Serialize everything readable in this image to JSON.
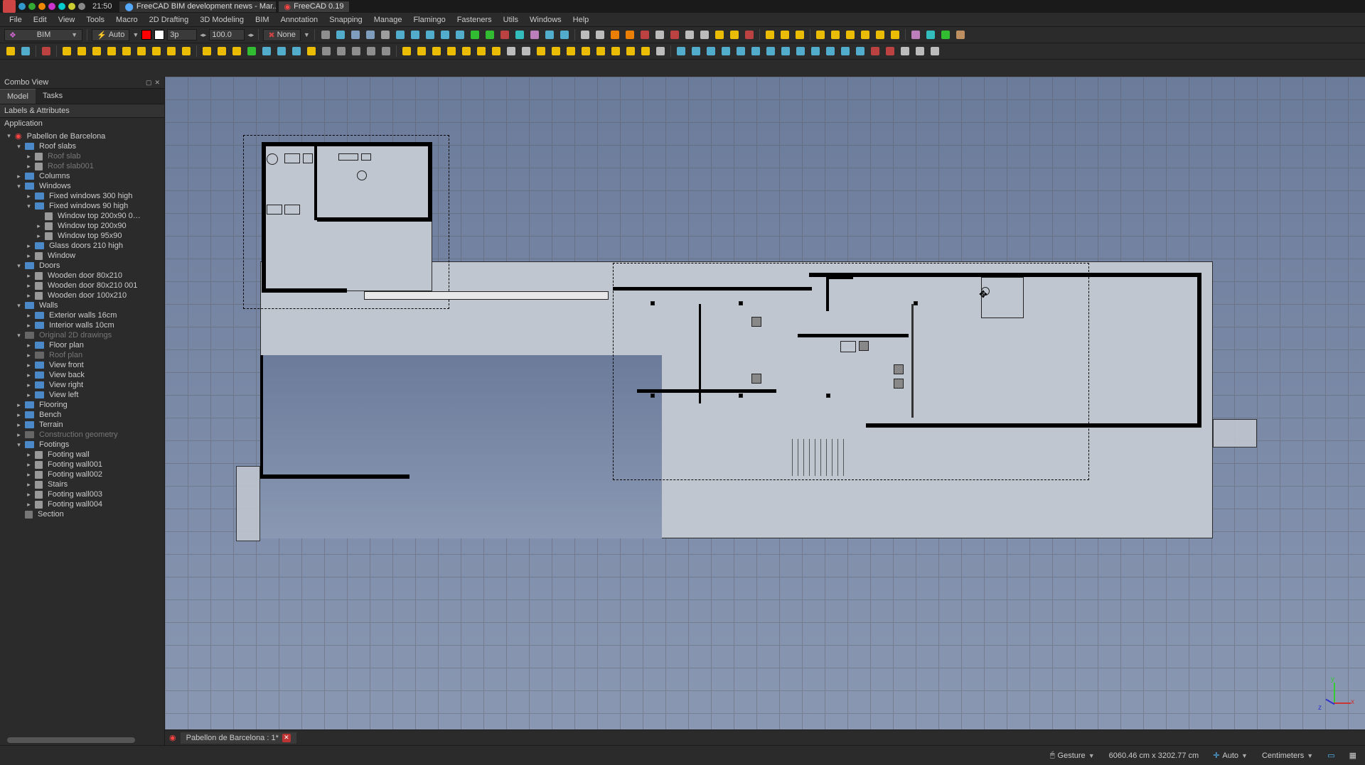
{
  "os": {
    "clock": "21:50",
    "tabs": [
      {
        "title": "FreeCAD BIM development news - Mar...",
        "active": false
      },
      {
        "title": "FreeCAD 0.19",
        "active": true
      }
    ]
  },
  "menubar": [
    "File",
    "Edit",
    "View",
    "Tools",
    "Macro",
    "2D Drafting",
    "3D Modeling",
    "BIM",
    "Annotation",
    "Snapping",
    "Manage",
    "Flamingo",
    "Fasteners",
    "Utils",
    "Windows",
    "Help"
  ],
  "toolbar1": {
    "workbench": "BIM",
    "autoGroup": "Auto",
    "colorPrimary": "#ff0000",
    "colorSecondary": "#ffffff",
    "lineWidth": "3p",
    "scale": "100.0",
    "constructMode": "None"
  },
  "combo": {
    "title": "Combo View",
    "tabs": [
      "Model",
      "Tasks"
    ],
    "activeTab": "Model",
    "sectionLabels": "Labels & Attributes",
    "sectionApp": "Application"
  },
  "tree": [
    {
      "d": 0,
      "t": "doc",
      "open": true,
      "label": "Pabellon de Barcelona"
    },
    {
      "d": 1,
      "t": "folder",
      "open": true,
      "label": "Roof slabs"
    },
    {
      "d": 2,
      "t": "item",
      "open": false,
      "label": "Roof slab",
      "dim": true
    },
    {
      "d": 2,
      "t": "item",
      "open": false,
      "label": "Roof slab001",
      "dim": true
    },
    {
      "d": 1,
      "t": "folder",
      "open": false,
      "label": "Columns"
    },
    {
      "d": 1,
      "t": "folder",
      "open": true,
      "label": "Windows"
    },
    {
      "d": 2,
      "t": "folder",
      "open": false,
      "label": "Fixed windows 300 high"
    },
    {
      "d": 2,
      "t": "folder",
      "open": true,
      "label": "Fixed windows 90 high"
    },
    {
      "d": 3,
      "t": "item",
      "open": false,
      "label": "Window top 200x90 0…",
      "notoggle": true
    },
    {
      "d": 3,
      "t": "item",
      "open": false,
      "label": "Window top 200x90"
    },
    {
      "d": 3,
      "t": "item",
      "open": false,
      "label": "Window top 95x90"
    },
    {
      "d": 2,
      "t": "folder",
      "open": false,
      "label": "Glass doors 210 high"
    },
    {
      "d": 2,
      "t": "item",
      "open": false,
      "label": "Window"
    },
    {
      "d": 1,
      "t": "folder",
      "open": true,
      "label": "Doors"
    },
    {
      "d": 2,
      "t": "item",
      "open": false,
      "label": "Wooden door 80x210"
    },
    {
      "d": 2,
      "t": "item",
      "open": false,
      "label": "Wooden door 80x210 001"
    },
    {
      "d": 2,
      "t": "item",
      "open": false,
      "label": "Wooden door 100x210"
    },
    {
      "d": 1,
      "t": "folder",
      "open": true,
      "label": "Walls"
    },
    {
      "d": 2,
      "t": "folder",
      "open": false,
      "label": "Exterior walls 16cm"
    },
    {
      "d": 2,
      "t": "folder",
      "open": false,
      "label": "Interior walls 10cm"
    },
    {
      "d": 1,
      "t": "folder",
      "open": true,
      "label": "Original 2D drawings",
      "dim": true
    },
    {
      "d": 2,
      "t": "folder",
      "open": false,
      "label": "Floor plan"
    },
    {
      "d": 2,
      "t": "folder",
      "open": false,
      "label": "Roof plan",
      "dim": true
    },
    {
      "d": 2,
      "t": "folder",
      "open": false,
      "label": "View front"
    },
    {
      "d": 2,
      "t": "folder",
      "open": false,
      "label": "View back"
    },
    {
      "d": 2,
      "t": "folder",
      "open": false,
      "label": "View right"
    },
    {
      "d": 2,
      "t": "folder",
      "open": false,
      "label": "View left"
    },
    {
      "d": 1,
      "t": "folder",
      "open": false,
      "label": "Flooring"
    },
    {
      "d": 1,
      "t": "folder",
      "open": false,
      "label": "Bench"
    },
    {
      "d": 1,
      "t": "folder",
      "open": false,
      "label": "Terrain"
    },
    {
      "d": 1,
      "t": "folder",
      "open": false,
      "label": "Construction geometry",
      "dim": true
    },
    {
      "d": 1,
      "t": "folder",
      "open": true,
      "label": "Footings"
    },
    {
      "d": 2,
      "t": "item",
      "open": false,
      "label": "Footing wall"
    },
    {
      "d": 2,
      "t": "item",
      "open": false,
      "label": "Footing wall001"
    },
    {
      "d": 2,
      "t": "item",
      "open": false,
      "label": "Footing wall002"
    },
    {
      "d": 2,
      "t": "item",
      "open": false,
      "label": "Stairs"
    },
    {
      "d": 2,
      "t": "item",
      "open": false,
      "label": "Footing wall003"
    },
    {
      "d": 2,
      "t": "item",
      "open": false,
      "label": "Footing wall004"
    },
    {
      "d": 1,
      "t": "item",
      "open": false,
      "label": "Section",
      "notoggle": true,
      "gray": true
    }
  ],
  "docTab": {
    "label": "Pabellon de Barcelona : 1*"
  },
  "status": {
    "nav": "Gesture",
    "dims": "6060.46 cm x 3202.77 cm",
    "snap": "Auto",
    "units": "Centimeters"
  },
  "icons": {
    "toolbarRow1": [
      "grid",
      "wp",
      "shade",
      "perspective",
      "wireframe",
      "snap-vertex",
      "snap-near",
      "snap-mid",
      "snap-perp",
      "snap-center",
      "snap-int",
      "snap-para",
      "snap-ext",
      "snap-special",
      "snap-ortho",
      "snap-dim",
      "wptop",
      "sep",
      "nudge",
      "views",
      "layer",
      "layers",
      "materials",
      "section",
      "doc",
      "sheet",
      "page",
      "terrain",
      "hatch",
      "color",
      "sep",
      "text-a",
      "text-s",
      "text-t",
      "sep",
      "dim-aligned",
      "dim-angle",
      "dim-leader",
      "dim-radius",
      "dim-grid",
      "compass",
      "sep",
      "gears",
      "boat",
      "globe",
      "boots"
    ],
    "toolbarRow2": [
      "new",
      "open",
      "sep",
      "decorate",
      "sep",
      "line",
      "wire",
      "circle",
      "arc-ccw",
      "arc-cw",
      "polygon",
      "rectangle",
      "bspline",
      "point",
      "sep",
      "wp-proxy",
      "cube",
      "cube2",
      "extrude",
      "placeholder",
      "grid2",
      "mesh",
      "ref",
      "sphere1",
      "sphere2",
      "tube",
      "cylinder",
      "cylinder2",
      "sep",
      "win",
      "door",
      "wall",
      "slab",
      "stair",
      "column",
      "beam",
      "minus",
      "chevron",
      "panel",
      "box",
      "build-col",
      "roof",
      "bolt",
      "build-wall",
      "build-slab",
      "build-frame",
      "ifc",
      "sep",
      "move",
      "clone",
      "rotate",
      "mirror",
      "offset",
      "trim",
      "extend",
      "2d",
      "pg",
      "sh",
      "up",
      "down",
      "mag",
      "glue",
      "del",
      "plus",
      "minus2",
      "user"
    ]
  }
}
